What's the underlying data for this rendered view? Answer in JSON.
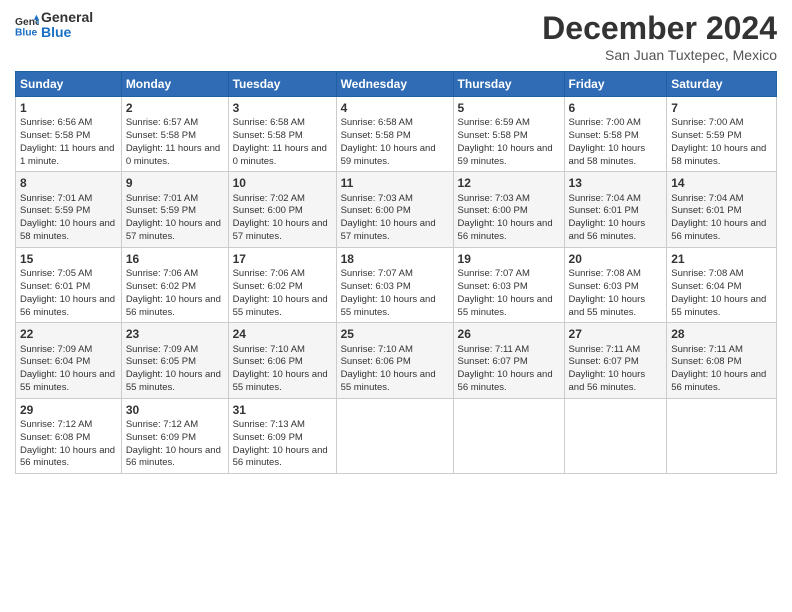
{
  "header": {
    "logo_line1": "General",
    "logo_line2": "Blue",
    "title": "December 2024",
    "subtitle": "San Juan Tuxtepec, Mexico"
  },
  "days_of_week": [
    "Sunday",
    "Monday",
    "Tuesday",
    "Wednesday",
    "Thursday",
    "Friday",
    "Saturday"
  ],
  "weeks": [
    [
      {
        "day": "1",
        "info": "Sunrise: 6:56 AM\nSunset: 5:58 PM\nDaylight: 11 hours and 1 minute."
      },
      {
        "day": "2",
        "info": "Sunrise: 6:57 AM\nSunset: 5:58 PM\nDaylight: 11 hours and 0 minutes."
      },
      {
        "day": "3",
        "info": "Sunrise: 6:58 AM\nSunset: 5:58 PM\nDaylight: 11 hours and 0 minutes."
      },
      {
        "day": "4",
        "info": "Sunrise: 6:58 AM\nSunset: 5:58 PM\nDaylight: 10 hours and 59 minutes."
      },
      {
        "day": "5",
        "info": "Sunrise: 6:59 AM\nSunset: 5:58 PM\nDaylight: 10 hours and 59 minutes."
      },
      {
        "day": "6",
        "info": "Sunrise: 7:00 AM\nSunset: 5:58 PM\nDaylight: 10 hours and 58 minutes."
      },
      {
        "day": "7",
        "info": "Sunrise: 7:00 AM\nSunset: 5:59 PM\nDaylight: 10 hours and 58 minutes."
      }
    ],
    [
      {
        "day": "8",
        "info": "Sunrise: 7:01 AM\nSunset: 5:59 PM\nDaylight: 10 hours and 58 minutes."
      },
      {
        "day": "9",
        "info": "Sunrise: 7:01 AM\nSunset: 5:59 PM\nDaylight: 10 hours and 57 minutes."
      },
      {
        "day": "10",
        "info": "Sunrise: 7:02 AM\nSunset: 6:00 PM\nDaylight: 10 hours and 57 minutes."
      },
      {
        "day": "11",
        "info": "Sunrise: 7:03 AM\nSunset: 6:00 PM\nDaylight: 10 hours and 57 minutes."
      },
      {
        "day": "12",
        "info": "Sunrise: 7:03 AM\nSunset: 6:00 PM\nDaylight: 10 hours and 56 minutes."
      },
      {
        "day": "13",
        "info": "Sunrise: 7:04 AM\nSunset: 6:01 PM\nDaylight: 10 hours and 56 minutes."
      },
      {
        "day": "14",
        "info": "Sunrise: 7:04 AM\nSunset: 6:01 PM\nDaylight: 10 hours and 56 minutes."
      }
    ],
    [
      {
        "day": "15",
        "info": "Sunrise: 7:05 AM\nSunset: 6:01 PM\nDaylight: 10 hours and 56 minutes."
      },
      {
        "day": "16",
        "info": "Sunrise: 7:06 AM\nSunset: 6:02 PM\nDaylight: 10 hours and 56 minutes."
      },
      {
        "day": "17",
        "info": "Sunrise: 7:06 AM\nSunset: 6:02 PM\nDaylight: 10 hours and 55 minutes."
      },
      {
        "day": "18",
        "info": "Sunrise: 7:07 AM\nSunset: 6:03 PM\nDaylight: 10 hours and 55 minutes."
      },
      {
        "day": "19",
        "info": "Sunrise: 7:07 AM\nSunset: 6:03 PM\nDaylight: 10 hours and 55 minutes."
      },
      {
        "day": "20",
        "info": "Sunrise: 7:08 AM\nSunset: 6:03 PM\nDaylight: 10 hours and 55 minutes."
      },
      {
        "day": "21",
        "info": "Sunrise: 7:08 AM\nSunset: 6:04 PM\nDaylight: 10 hours and 55 minutes."
      }
    ],
    [
      {
        "day": "22",
        "info": "Sunrise: 7:09 AM\nSunset: 6:04 PM\nDaylight: 10 hours and 55 minutes."
      },
      {
        "day": "23",
        "info": "Sunrise: 7:09 AM\nSunset: 6:05 PM\nDaylight: 10 hours and 55 minutes."
      },
      {
        "day": "24",
        "info": "Sunrise: 7:10 AM\nSunset: 6:06 PM\nDaylight: 10 hours and 55 minutes."
      },
      {
        "day": "25",
        "info": "Sunrise: 7:10 AM\nSunset: 6:06 PM\nDaylight: 10 hours and 55 minutes."
      },
      {
        "day": "26",
        "info": "Sunrise: 7:11 AM\nSunset: 6:07 PM\nDaylight: 10 hours and 56 minutes."
      },
      {
        "day": "27",
        "info": "Sunrise: 7:11 AM\nSunset: 6:07 PM\nDaylight: 10 hours and 56 minutes."
      },
      {
        "day": "28",
        "info": "Sunrise: 7:11 AM\nSunset: 6:08 PM\nDaylight: 10 hours and 56 minutes."
      }
    ],
    [
      {
        "day": "29",
        "info": "Sunrise: 7:12 AM\nSunset: 6:08 PM\nDaylight: 10 hours and 56 minutes."
      },
      {
        "day": "30",
        "info": "Sunrise: 7:12 AM\nSunset: 6:09 PM\nDaylight: 10 hours and 56 minutes."
      },
      {
        "day": "31",
        "info": "Sunrise: 7:13 AM\nSunset: 6:09 PM\nDaylight: 10 hours and 56 minutes."
      },
      {
        "day": "",
        "info": ""
      },
      {
        "day": "",
        "info": ""
      },
      {
        "day": "",
        "info": ""
      },
      {
        "day": "",
        "info": ""
      }
    ]
  ]
}
